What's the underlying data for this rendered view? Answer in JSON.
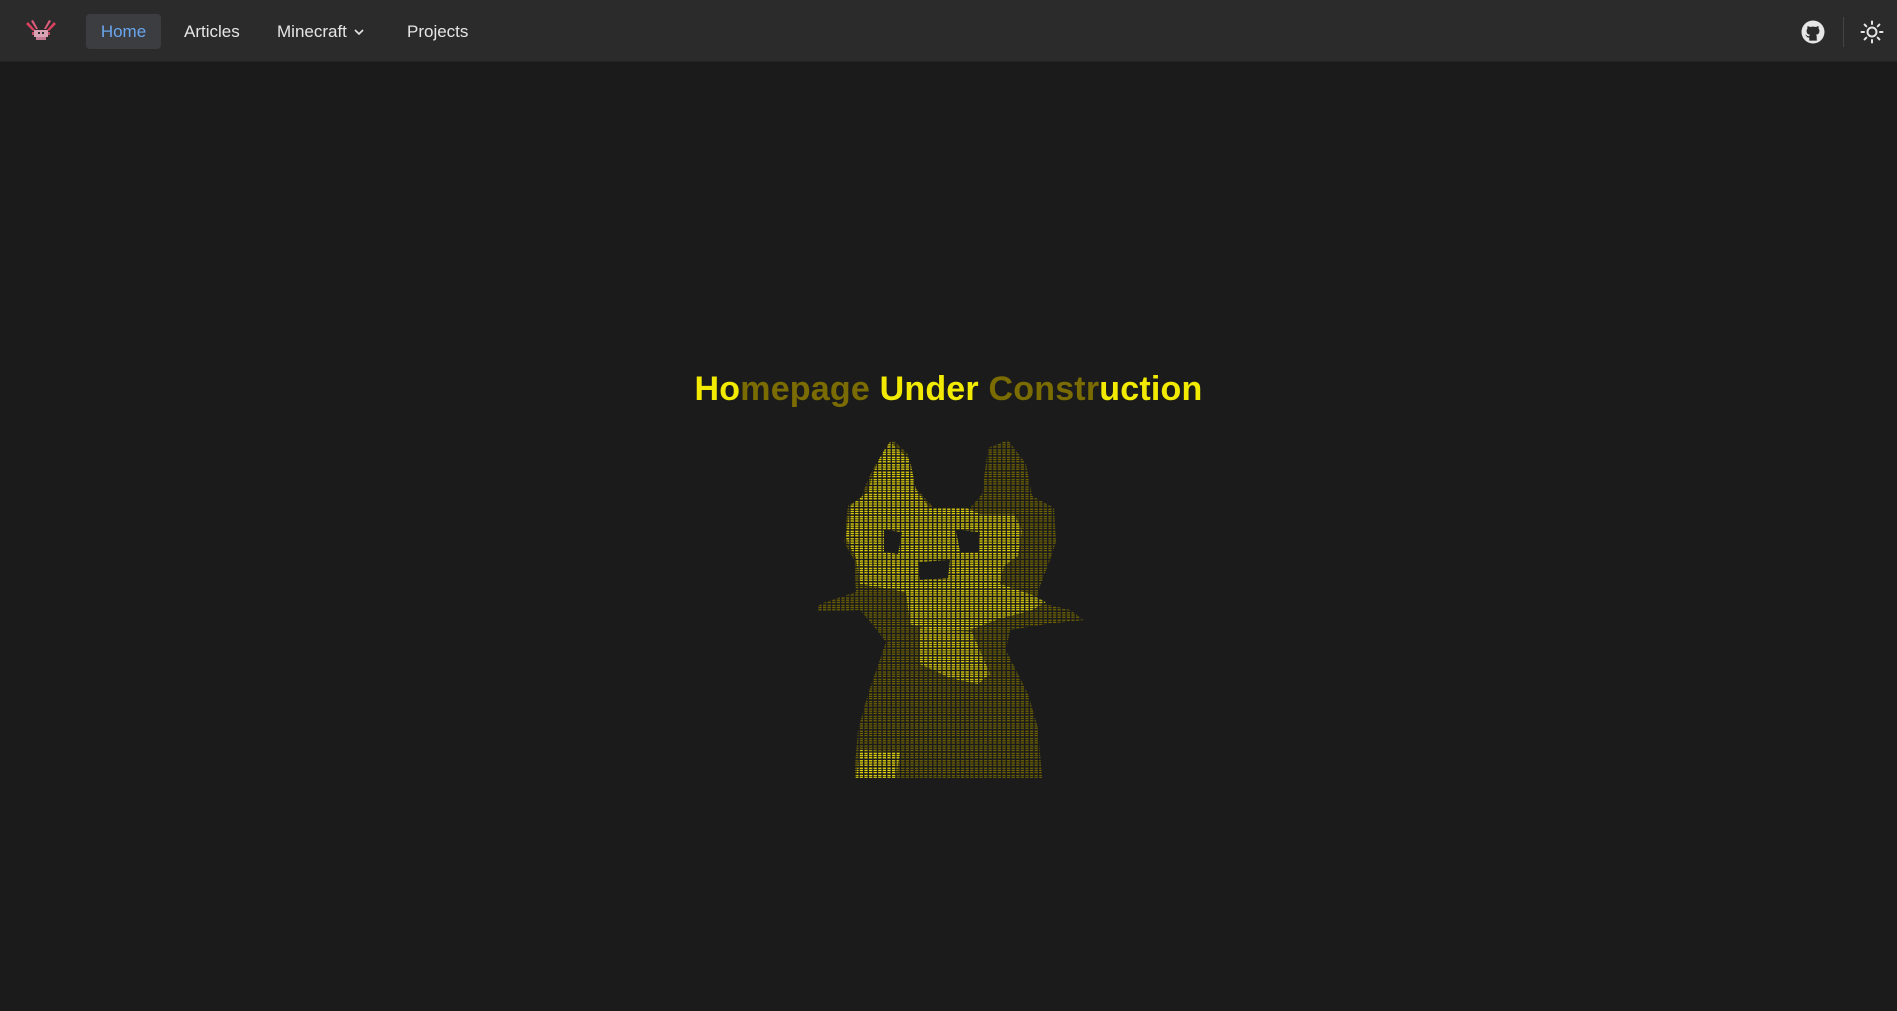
{
  "nav": {
    "logo_icon": "crab-logo-icon",
    "items": [
      {
        "label": "Home",
        "active": true
      },
      {
        "label": "Articles"
      },
      {
        "label": "Minecraft",
        "has_dropdown": true
      },
      {
        "label": "Projects"
      }
    ],
    "github_icon": "github-icon",
    "theme_icon": "sun-icon"
  },
  "main": {
    "title_parts": [
      "Ho",
      "mepage",
      " Under ",
      "Constr",
      "uction"
    ],
    "ascii_art_icon": "ascii-art-figure-icon"
  },
  "colors": {
    "background": "#1b1b1b",
    "navbar": "#2b2b2b",
    "accent": "#6aa6ef",
    "title_bright": "#f2ea00",
    "title_dim": "#7a6c00"
  }
}
